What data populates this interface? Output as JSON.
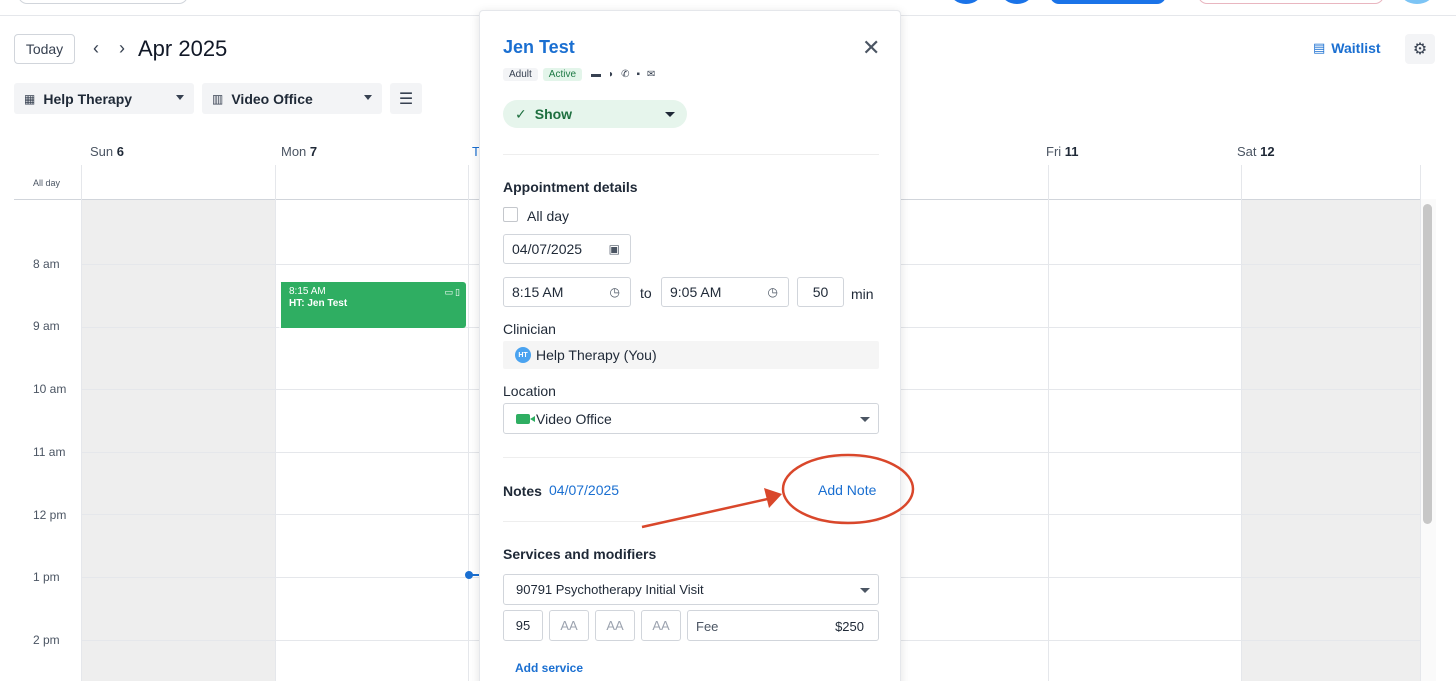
{
  "toolbar": {
    "today_label": "Today",
    "prev_icon": "chevron-left-icon",
    "next_icon": "chevron-right-icon",
    "month_title": "Apr 2025",
    "clinician_filter": "Help Therapy",
    "location_filter": "Video Office",
    "waitlist_label": "Waitlist"
  },
  "calendar": {
    "allday_label": "All day",
    "days": [
      {
        "name": "Sun",
        "num": "6"
      },
      {
        "name": "Mon",
        "num": "7"
      },
      {
        "name": "T",
        "num": ""
      },
      {
        "name": "Fri",
        "num": "11"
      },
      {
        "name": "Sat",
        "num": "12"
      }
    ],
    "hours": [
      "8 am",
      "9 am",
      "10 am",
      "11 am",
      "12 pm",
      "1 pm",
      "2 pm"
    ],
    "event": {
      "time": "8:15 AM",
      "title": "HT: Jen Test",
      "color": "#2fae62"
    }
  },
  "appointment": {
    "client_name": "Jen Test",
    "badges": [
      "Adult",
      "Active"
    ],
    "status": "Show",
    "details_title": "Appointment details",
    "allday_label": "All day",
    "date": "04/07/2025",
    "start_time": "8:15 AM",
    "to_label": "to",
    "end_time": "9:05 AM",
    "duration": "50",
    "duration_unit": "min",
    "clinician_label": "Clinician",
    "clinician_initials": "HT",
    "clinician_name": "Help Therapy (You)",
    "location_label": "Location",
    "location": "Video Office",
    "notes_label": "Notes",
    "notes_date": "04/07/2025",
    "add_note": "Add Note",
    "services_title": "Services and modifiers",
    "service": "90791 Psychotherapy Initial Visit",
    "modifiers": [
      "95",
      "AA",
      "AA",
      "AA"
    ],
    "fee_label": "Fee",
    "fee_value": "$250",
    "add_service": "Add service"
  },
  "colors": {
    "accent": "#1a6fd1",
    "event_green": "#2fae62",
    "annotation_red": "#d9472b"
  }
}
